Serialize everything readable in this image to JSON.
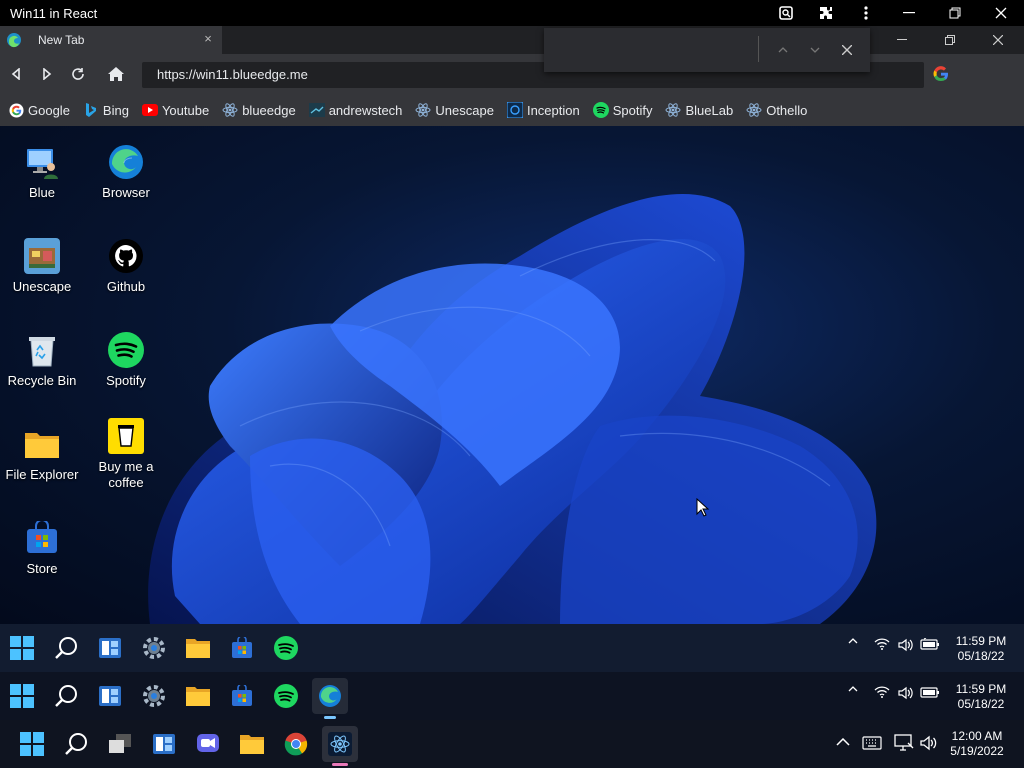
{
  "app": {
    "title": "Win11 in React"
  },
  "browser": {
    "tab": {
      "label": "New Tab",
      "close": "×"
    },
    "address": "https://win11.blueedge.me",
    "bookmarks": [
      {
        "label": "Google",
        "icon": "google-icon"
      },
      {
        "label": "Bing",
        "icon": "bing-icon"
      },
      {
        "label": "Youtube",
        "icon": "youtube-icon"
      },
      {
        "label": "blueedge",
        "icon": "react-icon"
      },
      {
        "label": "andrewstech",
        "icon": "andrewstech-icon"
      },
      {
        "label": "Unescape",
        "icon": "react-icon"
      },
      {
        "label": "Inception",
        "icon": "inception-icon"
      },
      {
        "label": "Spotify",
        "icon": "spotify-icon"
      },
      {
        "label": "BlueLab",
        "icon": "react-icon"
      },
      {
        "label": "Othello",
        "icon": "react-icon"
      }
    ]
  },
  "desktop": {
    "icons": [
      {
        "label": "Blue",
        "icon": "user-pc-icon"
      },
      {
        "label": "Browser",
        "icon": "edge-icon"
      },
      {
        "label": "Unescape",
        "icon": "unescape-icon"
      },
      {
        "label": "Github",
        "icon": "github-icon"
      },
      {
        "label": "Recycle Bin",
        "icon": "recycle-bin-icon"
      },
      {
        "label": "Spotify",
        "icon": "spotify-icon"
      },
      {
        "label": "File Explorer",
        "icon": "folder-icon"
      },
      {
        "label": "Buy me a coffee",
        "icon": "coffee-icon"
      },
      {
        "label": "Store",
        "icon": "store-icon"
      }
    ]
  },
  "taskbar_inner": {
    "clock_time": "11:59 PM",
    "clock_date": "05/18/22"
  },
  "taskbar_inner2": {
    "clock_time": "11:59 PM",
    "clock_date": "05/18/22"
  },
  "taskbar_host": {
    "clock_time": "12:00 AM",
    "clock_date": "5/19/2022"
  },
  "colors": {
    "accent": "#0078d4",
    "spotify": "#1ed760",
    "youtube": "#ff0000"
  }
}
